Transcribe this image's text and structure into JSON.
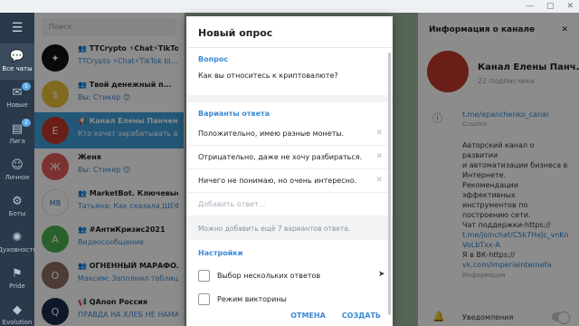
{
  "titlebar": {
    "close": "✕",
    "minimize": "—",
    "maximize": "▢"
  },
  "rail": {
    "items": [
      {
        "label": "Все чаты",
        "icon": "chat-bubbles-icon",
        "glyph": "💬",
        "badge": ""
      },
      {
        "label": "Новые",
        "icon": "new-icon",
        "glyph": "✉",
        "badge": "5"
      },
      {
        "label": "Лига",
        "icon": "league-icon",
        "glyph": "▤",
        "badge": "2"
      },
      {
        "label": "Личное",
        "icon": "person-icon",
        "glyph": "☺",
        "badge": ""
      },
      {
        "label": "Боты",
        "icon": "bot-icon",
        "glyph": "⚙",
        "badge": ""
      },
      {
        "label": "Духовность",
        "icon": "spirit-icon",
        "glyph": "✺",
        "badge": ""
      },
      {
        "label": "Pride",
        "icon": "pride-icon",
        "glyph": "⚑",
        "badge": ""
      },
      {
        "label": "Evolution",
        "icon": "evolution-icon",
        "glyph": "◆",
        "badge": ""
      }
    ]
  },
  "search": {
    "placeholder": "Поиск"
  },
  "chats": [
    {
      "name": "👥 TTCrypto ⚡Chat⚡TikTok...",
      "msg": "TTCrypto ⚡Chat⚡TikTok bl...",
      "sender": "",
      "color": "#111111",
      "initial": "✦",
      "badge": ""
    },
    {
      "name": "👥 Твой денежный п...",
      "msg": "Вы: Стикер 😊",
      "sender": "",
      "color": "#e8c13a",
      "initial": "$",
      "badge": ""
    },
    {
      "name": "📢 Канал Елены Панчен...",
      "msg": "Кто хочет зарабатывать в ин...",
      "sender": "",
      "color": "#c0392b",
      "initial": "Е",
      "badge": ""
    },
    {
      "name": "Женя",
      "msg": "Вы: Стикер 😊",
      "sender": "",
      "color": "#e45b5b",
      "initial": "Ж",
      "badge": ""
    },
    {
      "name": "👥 MarketBot. Ключевые ...",
      "msg": "Татьяна: Как сказала,ШЕФ 🤝",
      "sender": "Татьяна:",
      "color": "#ffffff",
      "initial": "MB",
      "badge": ""
    },
    {
      "name": "👥 #АнтиКризис2021",
      "msg": "Видеосообщение",
      "sender": "",
      "color": "#4caf50",
      "initial": "А",
      "badge": ""
    },
    {
      "name": "👥 ОГНЕННЫЙ МАРАФО...",
      "msg": "Максим: Заполнил таблицу",
      "sender": "Максим:",
      "color": "#8d6e63",
      "initial": "О",
      "badge": ""
    },
    {
      "name": "📢 QAnon Россия",
      "msg": "ПРАВДА НА ХЛЕБ НЕ НАМАЖ...",
      "sender": "",
      "color": "#1c2d4a",
      "initial": "Q",
      "badge": ""
    }
  ],
  "dialog": {
    "title": "Новый опрос",
    "question_label": "Вопрос",
    "question": "Как вы относитесь к криптовалюте?",
    "options_label": "Варианты ответа",
    "options": [
      "Положительно, имею разные монеты.",
      "Отрицательно, даже не хочу разбираться.",
      "Ничего не понимаю, но очень интересно."
    ],
    "add_option": "Добавить ответ...",
    "hint": "Можно добавить ещё 7 вариантов ответа.",
    "settings_label": "Настройки",
    "settings": [
      "Выбор нескольких ответов",
      "Режим викторины"
    ],
    "cancel": "ОТМЕНА",
    "create": "СОЗДАТЬ"
  },
  "info": {
    "header": "Информация о канале",
    "name": "Канал Елены Панч...",
    "subscribers": "22 подписчика",
    "link": "t.me/epanchenko_canal",
    "link_caption": "Ссылка",
    "description_lines": [
      "Авторский канал о развитии",
      "и автоматизации бизнеса в",
      "Интернете.",
      "Рекомендации эффективных",
      "инструментов по",
      "построению сети.",
      "Чат поддержки-https://",
      "t.me/joinchat/C5k7HxJc_vnKn",
      "VoLbTxx-A",
      "Я в ВК-https://",
      "vk.com/imperiainterneta"
    ],
    "description_caption": "Информация",
    "notifications": "Уведомления"
  }
}
